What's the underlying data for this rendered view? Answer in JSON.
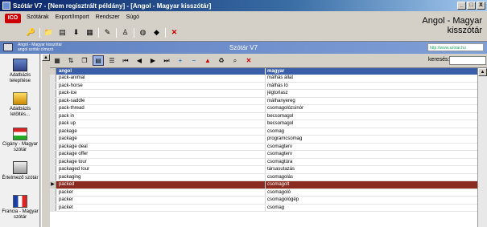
{
  "window": {
    "title": "Szótár V7 - [Nem regisztrált példány] - [Angol - Magyar kisszótár]",
    "buttons": [
      "_",
      "□",
      "X"
    ]
  },
  "logo_text": "ICO",
  "menu": [
    "Szótárak",
    "Export/Import",
    "Rendszer",
    "Súgó"
  ],
  "brand": {
    "line1": "Angol - Magyar",
    "line2": "kisszótár"
  },
  "subheader": {
    "left_line1": "Angol - Magyar kisszótár",
    "left_line2": "angol szótár címszó",
    "title": "Szótár V7",
    "url": "http://www.szotar.hu"
  },
  "sidebar": [
    {
      "label": "Adatbázis telepítése",
      "icon": "database-icon"
    },
    {
      "label": "Adatbázis letöltés...",
      "icon": "download-icon"
    },
    {
      "label": "Cigány - Magyar szótár",
      "icon": "hungarian-flag-icon"
    },
    {
      "label": "Értelmező szótár",
      "icon": "book-icon"
    },
    {
      "label": "Francia - Magyar szótár",
      "icon": "french-flag-icon"
    }
  ],
  "search": {
    "label": "keresés:",
    "value": ""
  },
  "grid": {
    "headers": {
      "en": "angol",
      "hu": "magyar"
    },
    "rows": [
      {
        "en": "pack-animal",
        "hu": "málhás állat"
      },
      {
        "en": "pack-horse",
        "hu": "málhás ló"
      },
      {
        "en": "pack-ice",
        "hu": "jégtorlasz"
      },
      {
        "en": "pack-saddle",
        "hu": "málhanyereg"
      },
      {
        "en": "pack-thread",
        "hu": "csomagolózsinór"
      },
      {
        "en": "pack in",
        "hu": "becsomagol"
      },
      {
        "en": "pack up",
        "hu": "becsomagol"
      },
      {
        "en": "package",
        "hu": "csomag"
      },
      {
        "en": "package",
        "hu": "programcsomag"
      },
      {
        "en": "package deal",
        "hu": "csomagterv"
      },
      {
        "en": "package offer",
        "hu": "csomagterv"
      },
      {
        "en": "package tour",
        "hu": "csomagtúra"
      },
      {
        "en": "packaged tour",
        "hu": "társasutazás"
      },
      {
        "en": "packaging",
        "hu": "csomagolás"
      },
      {
        "en": "packed",
        "hu": "csomagolt"
      },
      {
        "en": "packer",
        "hu": "csomagoló"
      },
      {
        "en": "packer",
        "hu": "csomagológép"
      },
      {
        "en": "packet",
        "hu": "csomag"
      }
    ],
    "selected_index": 14
  },
  "colors": {
    "selected_row": "#8b2a1e",
    "header": "#3b5ea8",
    "title_bar": "#0a246a"
  }
}
